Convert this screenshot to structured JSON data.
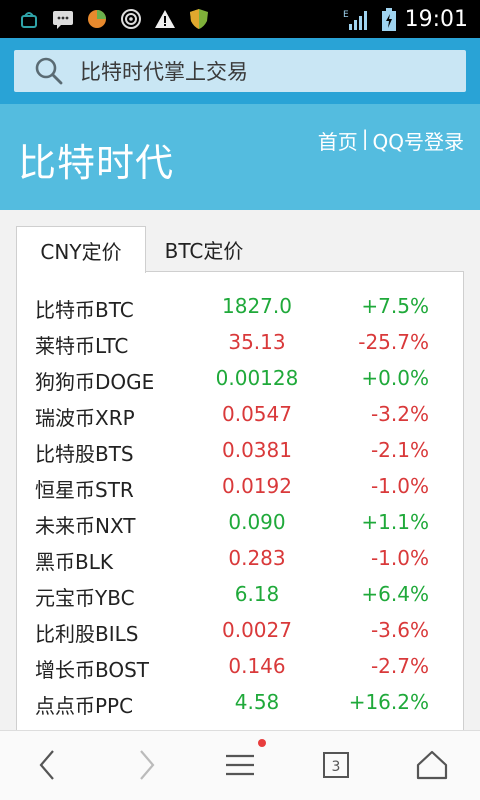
{
  "status_bar": {
    "time": "19:01",
    "icons": [
      "android-debug-icon",
      "message-icon",
      "app-badge-icon",
      "wifi-hotspot-icon",
      "warning-icon",
      "shield-icon",
      "network-e-signal-icon",
      "battery-charging-icon"
    ]
  },
  "search": {
    "text": "比特时代掌上交易"
  },
  "header": {
    "brand": "比特时代",
    "link_home": "首页",
    "separator": "|",
    "link_login": "QQ号登录"
  },
  "tabs": [
    {
      "label": "CNY定价",
      "active": true
    },
    {
      "label": "BTC定价",
      "active": false
    }
  ],
  "market": [
    {
      "name": "比特币BTC",
      "price": "1827.0",
      "change": "+7.5%",
      "trend": "up"
    },
    {
      "name": "莱特币LTC",
      "price": "35.13",
      "change": "-25.7%",
      "trend": "down"
    },
    {
      "name": "狗狗币DOGE",
      "price": "0.00128",
      "change": "+0.0%",
      "trend": "up"
    },
    {
      "name": "瑞波币XRP",
      "price": "0.0547",
      "change": "-3.2%",
      "trend": "down"
    },
    {
      "name": "比特股BTS",
      "price": "0.0381",
      "change": "-2.1%",
      "trend": "down"
    },
    {
      "name": "恒星币STR",
      "price": "0.0192",
      "change": "-1.0%",
      "trend": "down"
    },
    {
      "name": "未来币NXT",
      "price": "0.090",
      "change": "+1.1%",
      "trend": "up"
    },
    {
      "name": "黑币BLK",
      "price": "0.283",
      "change": "-1.0%",
      "trend": "down"
    },
    {
      "name": "元宝币YBC",
      "price": "6.18",
      "change": "+6.4%",
      "trend": "up"
    },
    {
      "name": "比利股BILS",
      "price": "0.0027",
      "change": "-3.6%",
      "trend": "down"
    },
    {
      "name": "增长币BOST",
      "price": "0.146",
      "change": "-2.7%",
      "trend": "down"
    },
    {
      "name": "点点币PPC",
      "price": "4.58",
      "change": "+16.2%",
      "trend": "up"
    }
  ],
  "bottom_nav": {
    "tab_count": "3",
    "items": [
      "back-icon",
      "forward-icon",
      "menu-icon",
      "tabs-icon",
      "home-icon"
    ]
  },
  "colors": {
    "search_bg": "#29a3d6",
    "header_bg": "#54bcdf",
    "up": "#1fa93a",
    "down": "#d9393a"
  }
}
